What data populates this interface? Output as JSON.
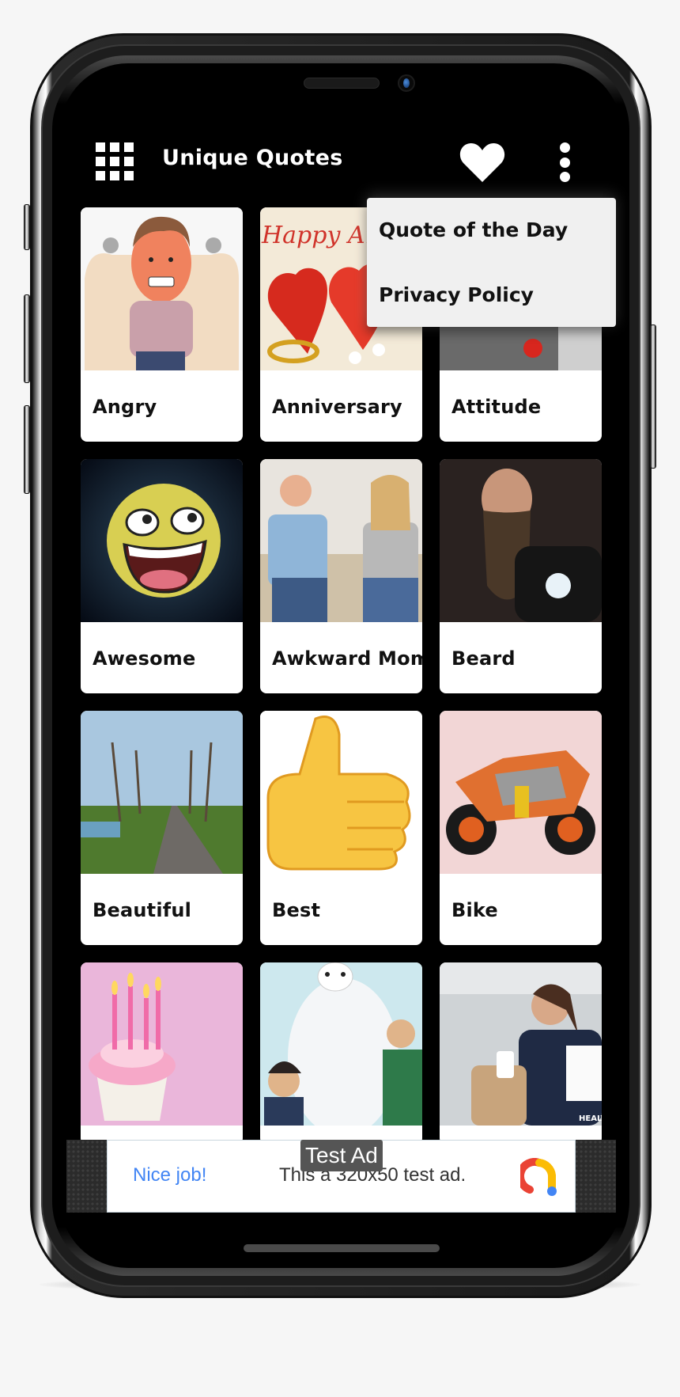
{
  "app": {
    "title": "Unique Quotes"
  },
  "toolbar": {
    "menu_icon": "grid-icon",
    "favorite_icon": "heart-icon",
    "overflow_icon": "more-vert-icon"
  },
  "popup_menu": {
    "items": [
      {
        "label": "Quote of the Day"
      },
      {
        "label": "Privacy Policy"
      }
    ]
  },
  "categories": [
    {
      "label": "Angry",
      "image": "angry cartoon man with steam"
    },
    {
      "label": "Anniversary",
      "image": "red hearts with gold rings"
    },
    {
      "label": "Attitude",
      "image": "person in knit sweater with red watch"
    },
    {
      "label": "Awesome",
      "image": "awesome smiley face in space"
    },
    {
      "label": "Awkward Mome",
      "image": "arguing couple on couch"
    },
    {
      "label": "Beard",
      "image": "bearded bald man"
    },
    {
      "label": "Beautiful",
      "image": "tree-lined country road"
    },
    {
      "label": "Best",
      "image": "thumbs up emoji"
    },
    {
      "label": "Bike",
      "image": "orange sport motorcycle"
    },
    {
      "label": "",
      "image": "birthday cupcake with candles"
    },
    {
      "label": "",
      "image": "big hero 6 characters"
    },
    {
      "label": "",
      "image": "smiling businesswoman on phone"
    }
  ],
  "ad": {
    "badge": "Test Ad",
    "headline": "Nice job!",
    "body": "This a 320x50 test ad.",
    "colors": {
      "headline": "#4285f4",
      "red": "#ea4335",
      "yellow": "#fbbc04",
      "blue": "#4285f4"
    }
  }
}
